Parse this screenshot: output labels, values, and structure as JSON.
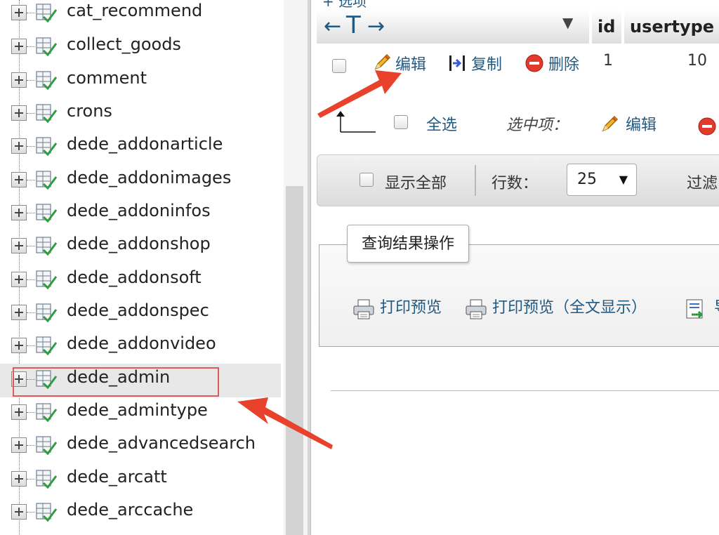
{
  "tree": {
    "items": [
      {
        "label": "cat_recommend",
        "selected": false
      },
      {
        "label": "collect_goods",
        "selected": false
      },
      {
        "label": "comment",
        "selected": false
      },
      {
        "label": "crons",
        "selected": false
      },
      {
        "label": "dede_addonarticle",
        "selected": false
      },
      {
        "label": "dede_addonimages",
        "selected": false
      },
      {
        "label": "dede_addoninfos",
        "selected": false
      },
      {
        "label": "dede_addonshop",
        "selected": false
      },
      {
        "label": "dede_addonsoft",
        "selected": false
      },
      {
        "label": "dede_addonspec",
        "selected": false
      },
      {
        "label": "dede_addonvideo",
        "selected": false
      },
      {
        "label": "dede_admin",
        "selected": true
      },
      {
        "label": "dede_admintype",
        "selected": false
      },
      {
        "label": "dede_advancedsearch",
        "selected": false
      },
      {
        "label": "dede_arcatt",
        "selected": false
      },
      {
        "label": "dede_arccache",
        "selected": false
      }
    ]
  },
  "options_link": "+ 选项",
  "table": {
    "arrows": {
      "left": "←",
      "t": "T",
      "right": "→"
    },
    "sort_icon": "▼",
    "columns": {
      "id": "id",
      "usertype": "usertype"
    },
    "row": {
      "edit": "编辑",
      "copy": "复制",
      "delete": "删除",
      "id": "1",
      "usertype": "10"
    }
  },
  "select_row": {
    "select_all": "全选",
    "with_selected": "选中项：",
    "edit": "编辑"
  },
  "navbar": {
    "show_all": "显示全部",
    "rows_label": "行数：",
    "rows_value": "25",
    "filter": "过滤"
  },
  "query_ops": {
    "legend": "查询结果操作",
    "print_preview": "打印预览",
    "print_preview_full": "打印预览（全文显示）",
    "export_partial": "导"
  },
  "colors": {
    "link": "#235a81",
    "annotation": "#e8412c",
    "highlight_box": "#e05a5a"
  }
}
